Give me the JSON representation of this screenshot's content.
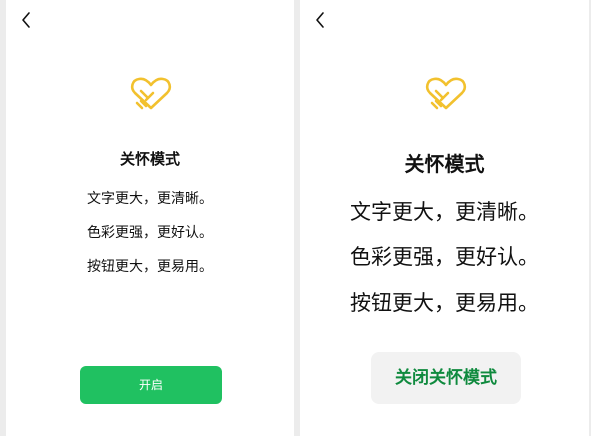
{
  "left": {
    "title": "关怀模式",
    "lines": [
      "文字更大，更清晰。",
      "色彩更强，更好认。",
      "按钮更大，更易用。"
    ],
    "button_label": "开启"
  },
  "right": {
    "title": "关怀模式",
    "lines": [
      "文字更大，更清晰。",
      "色彩更强，更好认。",
      "按钮更大，更易用。"
    ],
    "button_label": "关闭关怀模式"
  },
  "icons": {
    "back": "chevron-left-icon",
    "logo": "heart-hand-icon"
  },
  "colors": {
    "accent_green": "#20c161",
    "logo_gold": "#f2c12e",
    "off_button_text": "#0f8a3e",
    "off_button_bg": "#f2f2f2"
  }
}
